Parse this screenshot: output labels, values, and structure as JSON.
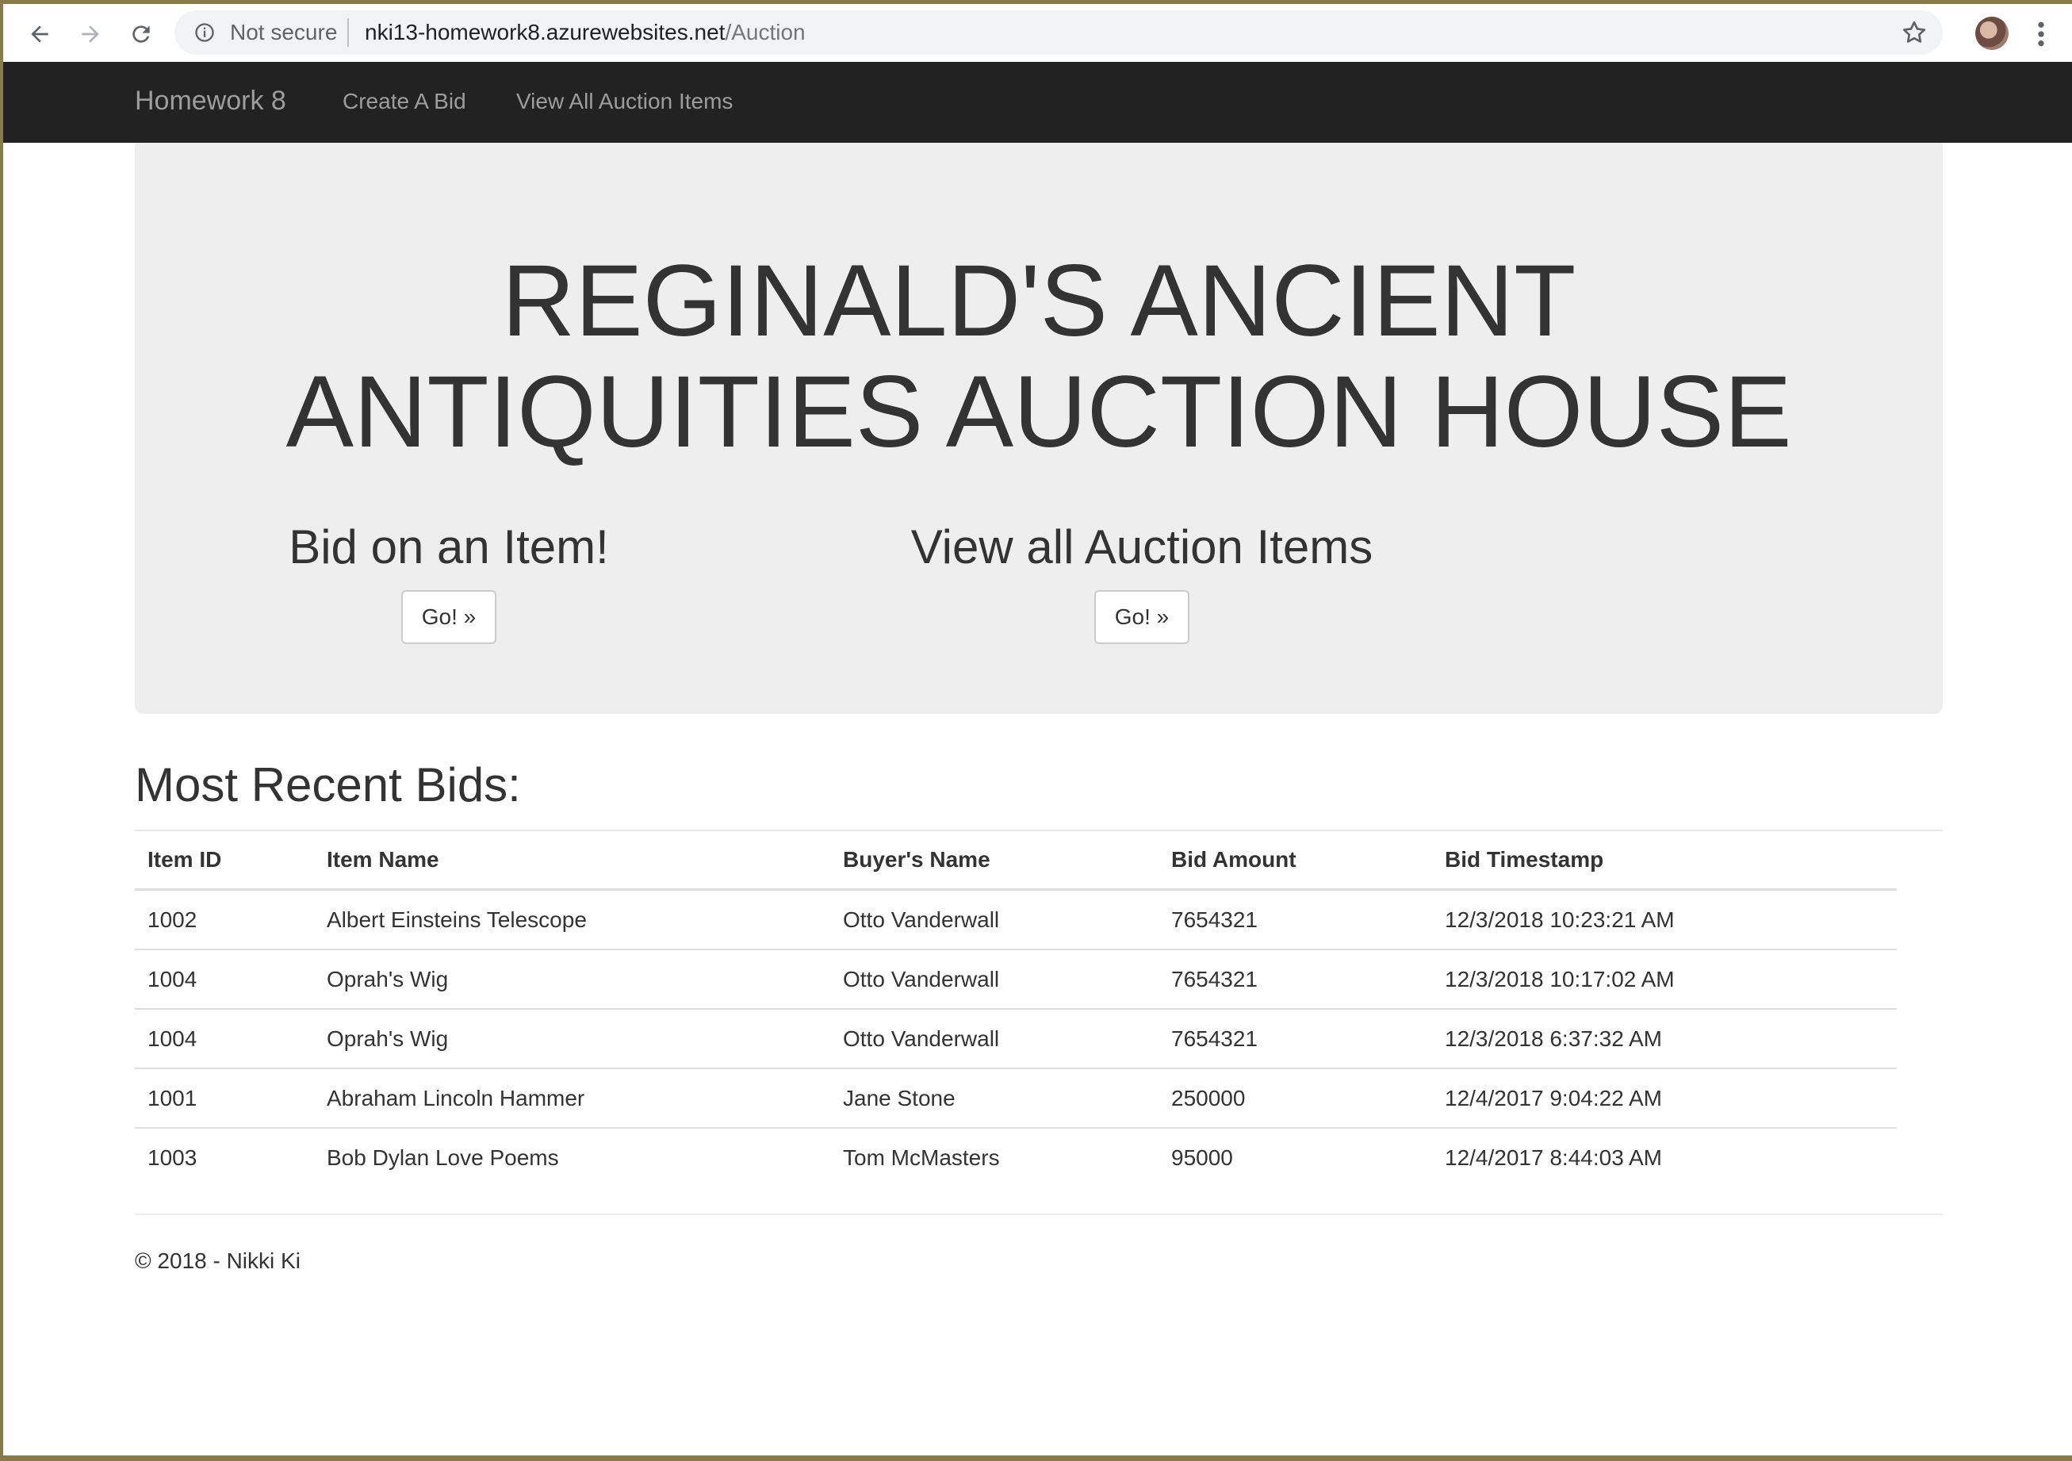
{
  "browser": {
    "security_label": "Not secure",
    "url_host": "nki13-homework8.azurewebsites.net",
    "url_path": "/Auction"
  },
  "navbar": {
    "brand": "Homework 8",
    "links": [
      "Create A Bid",
      "View All Auction Items"
    ]
  },
  "hero": {
    "title_line1": "REGINALD'S ANCIENT",
    "title_line2": "ANTIQUITIES AUCTION HOUSE",
    "cta_bid": {
      "heading": "Bid on an Item!",
      "button": "Go! »"
    },
    "cta_view": {
      "heading": "View all Auction Items",
      "button": "Go! »"
    }
  },
  "bids": {
    "title": "Most Recent Bids:",
    "columns": [
      "Item ID",
      "Item Name",
      "Buyer's Name",
      "Bid Amount",
      "Bid Timestamp"
    ],
    "rows": [
      [
        "1002",
        "Albert Einsteins Telescope",
        "Otto Vanderwall",
        "7654321",
        "12/3/2018 10:23:21 AM"
      ],
      [
        "1004",
        "Oprah's Wig",
        "Otto Vanderwall",
        "7654321",
        "12/3/2018 10:17:02 AM"
      ],
      [
        "1004",
        "Oprah's Wig",
        "Otto Vanderwall",
        "7654321",
        "12/3/2018 6:37:32 AM"
      ],
      [
        "1001",
        "Abraham Lincoln Hammer",
        "Jane Stone",
        "250000",
        "12/4/2017 9:04:22 AM"
      ],
      [
        "1003",
        "Bob Dylan Love Poems",
        "Tom McMasters",
        "95000",
        "12/4/2017 8:44:03 AM"
      ]
    ]
  },
  "footer": {
    "text": "© 2018 - Nikki Ki"
  },
  "icons": {
    "back": "arrow-left-icon",
    "forward": "arrow-right-icon",
    "reload": "reload-icon",
    "info": "info-icon",
    "bookmark": "star-icon",
    "menu": "kebab-menu-icon"
  },
  "colors": {
    "navbar_bg": "#222222",
    "navbar_text": "#9d9d9d",
    "jumbotron_bg": "#eeeeee",
    "text": "#333333"
  }
}
